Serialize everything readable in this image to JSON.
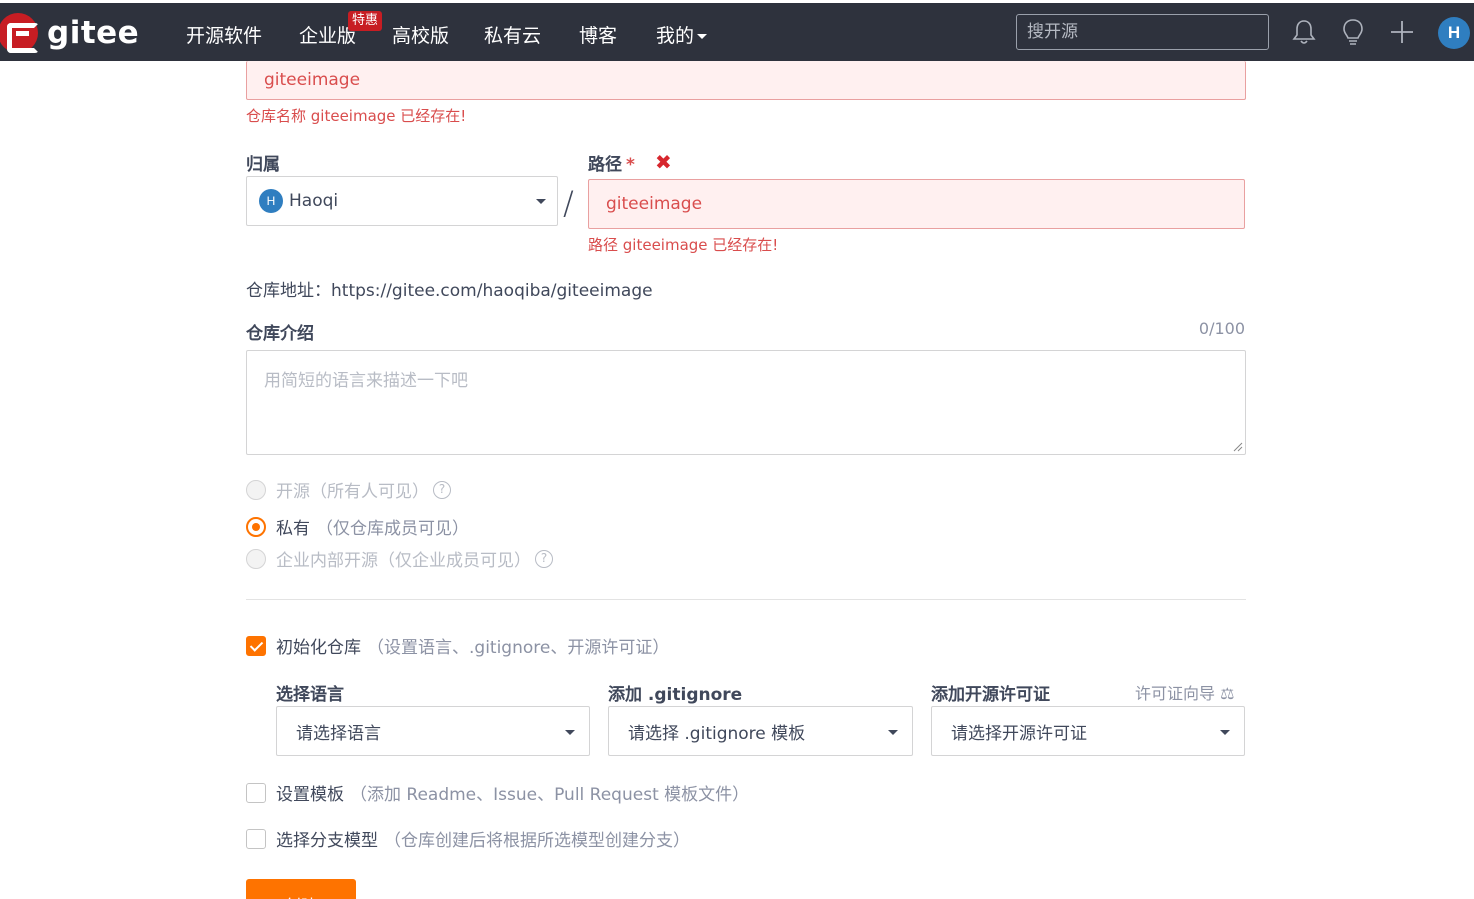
{
  "nav": {
    "brand": "gitee",
    "items": [
      "开源软件",
      "企业版",
      "高校版",
      "私有云",
      "博客",
      "我的"
    ],
    "hot_badge": "特惠",
    "search_placeholder": "搜开源",
    "avatar": "H",
    "icons": [
      "bell-icon",
      "lightbulb-icon",
      "plus-icon"
    ]
  },
  "form": {
    "repo_name_value": "giteeimage",
    "repo_name_error": "仓库名称 giteeimage 已经存在!",
    "owner_label": "归属",
    "owner_avatar": "H",
    "owner_value": "Haoqi",
    "path_label": "路径",
    "required_mark": "*",
    "path_value": "giteeimage",
    "path_error": "路径 giteeimage 已经存在!",
    "repo_address": "仓库地址：https://gitee.com/haoqiba/giteeimage",
    "desc_label": "仓库介绍",
    "desc_counter": "0/100",
    "desc_placeholder": "用简短的语言来描述一下吧",
    "visibility": [
      {
        "label": "开源",
        "hint": "（所有人可见）",
        "selected": false,
        "disabled": true,
        "help": "?"
      },
      {
        "label": "私有",
        "hint": "（仅仓库成员可见）",
        "selected": true,
        "disabled": false
      },
      {
        "label": "企业内部开源",
        "hint": "（仅企业成员可见）",
        "selected": false,
        "disabled": true,
        "help": "?"
      }
    ],
    "init_repo": {
      "label": "初始化仓库",
      "hint": "（设置语言、.gitignore、开源许可证）",
      "checked": true
    },
    "language": {
      "label": "选择语言",
      "value": "请选择语言"
    },
    "gitignore": {
      "label": "添加 .gitignore",
      "value": "请选择 .gitignore 模板"
    },
    "license": {
      "label": "添加开源许可证",
      "value": "请选择开源许可证",
      "wizard": "许可证向导"
    },
    "template": {
      "label": "设置模板",
      "hint": "（添加 Readme、Issue、Pull Request 模板文件）",
      "checked": false
    },
    "branch_model": {
      "label": "选择分支模型",
      "hint": "（仓库创建后将根据所选模型创建分支）",
      "checked": false
    },
    "create_button": "创建"
  },
  "colors": {
    "accent": "#fe7300",
    "error": "#d94d4d",
    "nav_bg": "#2e323d",
    "brand_red": "#c71d23"
  }
}
